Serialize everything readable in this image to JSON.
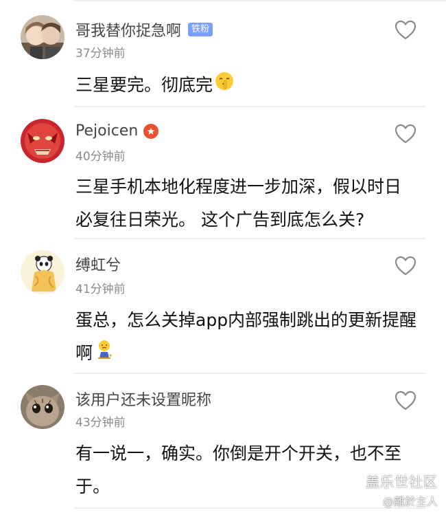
{
  "comments": [
    {
      "username": "哥我替你捉急啊",
      "badge": "铁粉",
      "time": "37分钟前",
      "lines": [
        "三星要完。彻底完"
      ],
      "emoji": "shushing-face"
    },
    {
      "username": "Pejoicen",
      "time": "40分钟前",
      "lines": [
        "三星手机本地化程度进一步加深，假以时日",
        "必复往日荣光。 这个广告到底怎么关?"
      ]
    },
    {
      "username": "缚虹兮",
      "time": "41分钟前",
      "lines": [
        "蛋总，怎么关掉app内部强制跳出的更新提醒",
        "啊"
      ],
      "emoji": "sitting-person"
    },
    {
      "username": "该用户还未设置昵称",
      "time": "43分钟前",
      "lines": [
        "有一说一，确实。你倒是开个开关，也不至",
        "于。"
      ]
    }
  ],
  "watermark": {
    "title": "盖乐世社区",
    "author": "@離於主人"
  },
  "colors": {
    "badge_bg": "#7aa0ff",
    "verify": "#e8502f",
    "time": "#8a8a8a"
  }
}
